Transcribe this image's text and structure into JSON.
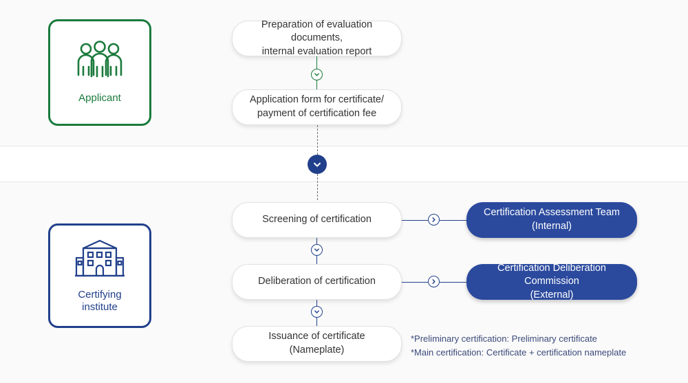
{
  "diagram": {
    "type": "flowchart",
    "actors": [
      {
        "id": "applicant",
        "label": "Applicant",
        "icon": "people-group-icon",
        "color": "#1a7a3c"
      },
      {
        "id": "certifying-institute",
        "label": "Certifying\ninstitute",
        "label_line1": "Certifying",
        "label_line2": "institute",
        "icon": "building-icon",
        "color": "#21408b"
      }
    ],
    "steps": [
      {
        "id": "step-1",
        "line1": "Preparation of evaluation documents,",
        "line2": "internal evaluation report"
      },
      {
        "id": "step-2",
        "line1": "Application form for certificate/",
        "line2": "payment of certification fee"
      },
      {
        "id": "step-3",
        "line1": "Screening of certification",
        "line2": ""
      },
      {
        "id": "step-4",
        "line1": "Deliberation of certification",
        "line2": ""
      },
      {
        "id": "step-5",
        "line1": "Issuance of certificate (Nameplate)",
        "line2": ""
      }
    ],
    "side_nodes": [
      {
        "id": "assessment-team",
        "line1": "Certification Assessment Team",
        "line2": "(Internal)"
      },
      {
        "id": "deliberation-commission",
        "line1": "Certification Deliberation Commission",
        "line2": "(External)"
      }
    ],
    "notes": [
      "*Preliminary certification: Preliminary certificate",
      "*Main certification: Certificate + certification nameplate"
    ],
    "colors": {
      "green": "#1a7a3c",
      "navy": "#21408b",
      "blue_pill": "#2b4a9e",
      "band": "#fafafa"
    }
  }
}
